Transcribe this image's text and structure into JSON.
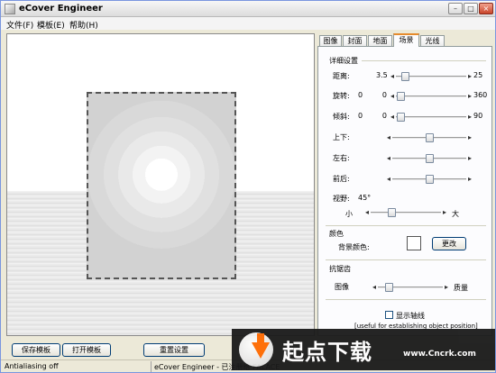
{
  "window": {
    "title": "eCover Engineer",
    "controls": {
      "minimize": "–",
      "maximize": "□",
      "close": "×"
    }
  },
  "menu": [
    "文件(F)",
    "模板(E)",
    "帮助(H)"
  ],
  "tabs": [
    "图像",
    "封面",
    "地面",
    "场景",
    "光线"
  ],
  "active_tab": "场景",
  "scene": {
    "detail_title": "详细设置",
    "sliders": [
      {
        "label": "距离:",
        "min": "3.5",
        "max": "25",
        "position": 0.08
      },
      {
        "label": "旋转:",
        "min_left": "0",
        "min": "0",
        "max": "360",
        "position": 0.02
      },
      {
        "label": "倾斜:",
        "min_left": "0",
        "min": "0",
        "max": "90",
        "position": 0.02
      },
      {
        "label": "上下:",
        "position": 0.5
      },
      {
        "label": "左右:",
        "position": 0.5
      },
      {
        "label": "前后:",
        "position": 0.5
      }
    ],
    "fov": {
      "label": "视野:",
      "value": "45°",
      "min_label": "小",
      "max_label": "大",
      "position": 0.28
    },
    "color_title": "颜色",
    "bg_color_label": "背景颜色:",
    "bg_color": "#ffffff",
    "change_button": "更改",
    "aa_title": "抗锯齿",
    "aa_slider": {
      "label": "图像",
      "max_label": "质量",
      "position": 0.12
    },
    "show_axes_label": "显示轴线",
    "show_axes_checked": false,
    "axes_hint": "[useful for establishing object position]"
  },
  "buttons": {
    "save_template": "保存模板",
    "open_template": "打开模板",
    "reset": "重置设置"
  },
  "status": {
    "left": "Antialiasing off",
    "right": "eCover Engineer - 已注册给 PALACE"
  },
  "watermark": {
    "brand": "起点下载",
    "url": "www.Cncrk.com"
  },
  "colors": {
    "accent_tab": "#e68b2c",
    "watermark_arrow": "#ff6a00"
  }
}
